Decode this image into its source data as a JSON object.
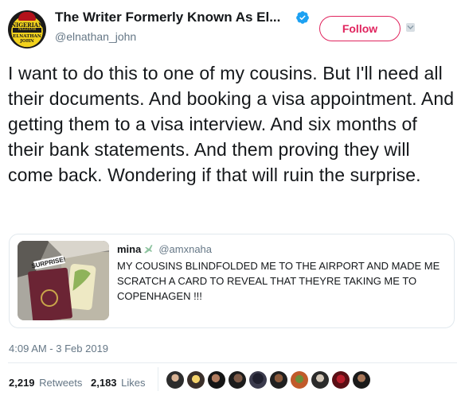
{
  "author": {
    "display_name": "The Writer Formerly Known As El...",
    "handle": "@elnathan_john",
    "avatar_text_top": "NIGERIAN",
    "avatar_text_band": "NIGERIAN",
    "avatar_text_bottom": "ELNATHAN JOHN"
  },
  "follow_button": {
    "label": "Follow"
  },
  "tweet_text": "I want to do this to one of my cousins. But I'll need all their documents. And booking a visa appointment. And getting them to a visa interview. And six months of their bank statements. And them proving they will come back. Wondering if that will ruin the surprise.",
  "quoted_tweet": {
    "author_name": "mina",
    "handle": "@amxnaha",
    "text": "MY COUSINS BLINDFOLDED ME TO THE AIRPORT AND MADE ME SCRATCH A CARD TO REVEAL THAT THEYRE TAKING ME TO COPENHAGEN !!!",
    "image_text": "SURPRISE!"
  },
  "timestamp": "4:09 AM - 3 Feb 2019",
  "stats": {
    "retweets_count": "2,219",
    "retweets_label": "Retweets",
    "likes_count": "2,183",
    "likes_label": "Likes"
  },
  "colors": {
    "follow_accent": "#e0245e",
    "verified_blue": "#1da1f2",
    "secondary_text": "#657786"
  },
  "icons": [
    "verified-badge-icon",
    "caret-down-icon",
    "airplane-emoji-icon"
  ]
}
